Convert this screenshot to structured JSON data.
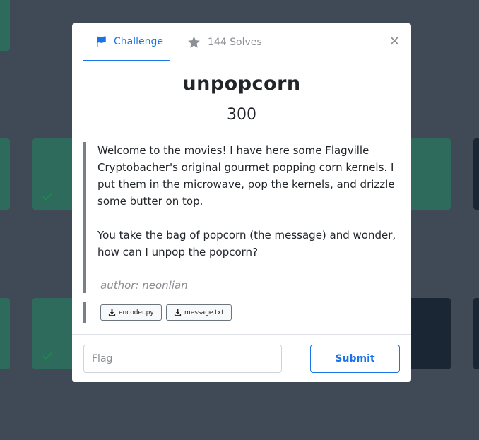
{
  "modal": {
    "tabs": {
      "challenge_label": "Challenge",
      "solves_label": "144 Solves"
    },
    "close_label": "×",
    "title": "unpopcorn",
    "points": "300",
    "description": [
      "Welcome to the movies! I have here some Flagville Cryptobacher's original gourmet popping corn kernels. I put them in the microwave, pop the kernels, and drizzle some butter on top.",
      "You take the bag of popcorn (the message) and wonder, how can I unpop the popcorn?"
    ],
    "author": "author: neonlian",
    "files": [
      "encoder.py",
      "message.txt"
    ],
    "flag_placeholder": "Flag",
    "submit_label": "Submit"
  },
  "colors": {
    "accent": "#1a73e8",
    "solved_card": "#2f6b5d",
    "unsolved_card": "#1a2634",
    "overlay_bg": "#3f4a56"
  },
  "icons": {
    "challenge_tab": "flag-icon",
    "solves_tab": "star-icon",
    "file": "download-icon",
    "solved_card": "check-icon",
    "close": "close-icon"
  }
}
